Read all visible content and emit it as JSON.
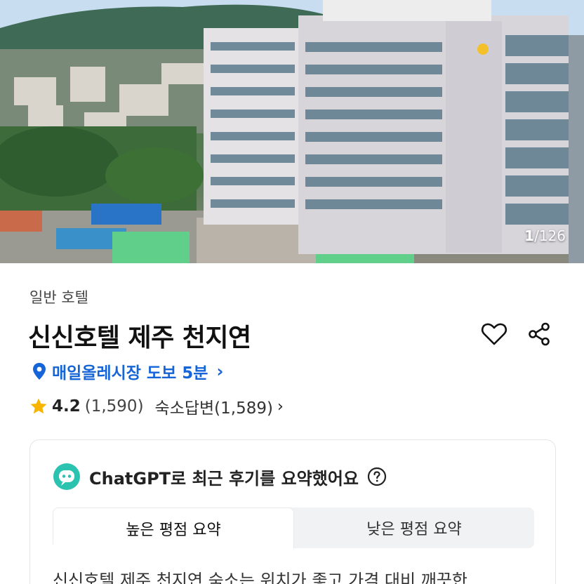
{
  "gallery": {
    "current": "1",
    "separator": "/",
    "total": "126"
  },
  "hotel": {
    "category": "일반 호텔",
    "name": "신신호텔 제주 천지연",
    "location": "매일올레시장 도보 5분",
    "rating": "4.2",
    "review_count": "(1,590)",
    "host_replies": "숙소답변(1,589)"
  },
  "ai_summary": {
    "title": "ChatGPT로 최근 후기를 요약했어요",
    "tabs": [
      {
        "label": "높은 평점 요약",
        "active": true
      },
      {
        "label": "낮은 평점 요약",
        "active": false
      }
    ],
    "text": "신신호텔 제주 천지연 숙소는 위치가 좋고 가격 대비 깨끗한"
  },
  "icons": {
    "heart": "heart-icon",
    "share": "share-icon",
    "pin": "location-pin-icon",
    "star": "star-icon",
    "chatgpt": "chatgpt-bot-icon",
    "help": "question-circle-icon"
  },
  "colors": {
    "accent_blue": "#1565d8",
    "star": "#f7b500",
    "bot_teal": "#29c3b0"
  }
}
